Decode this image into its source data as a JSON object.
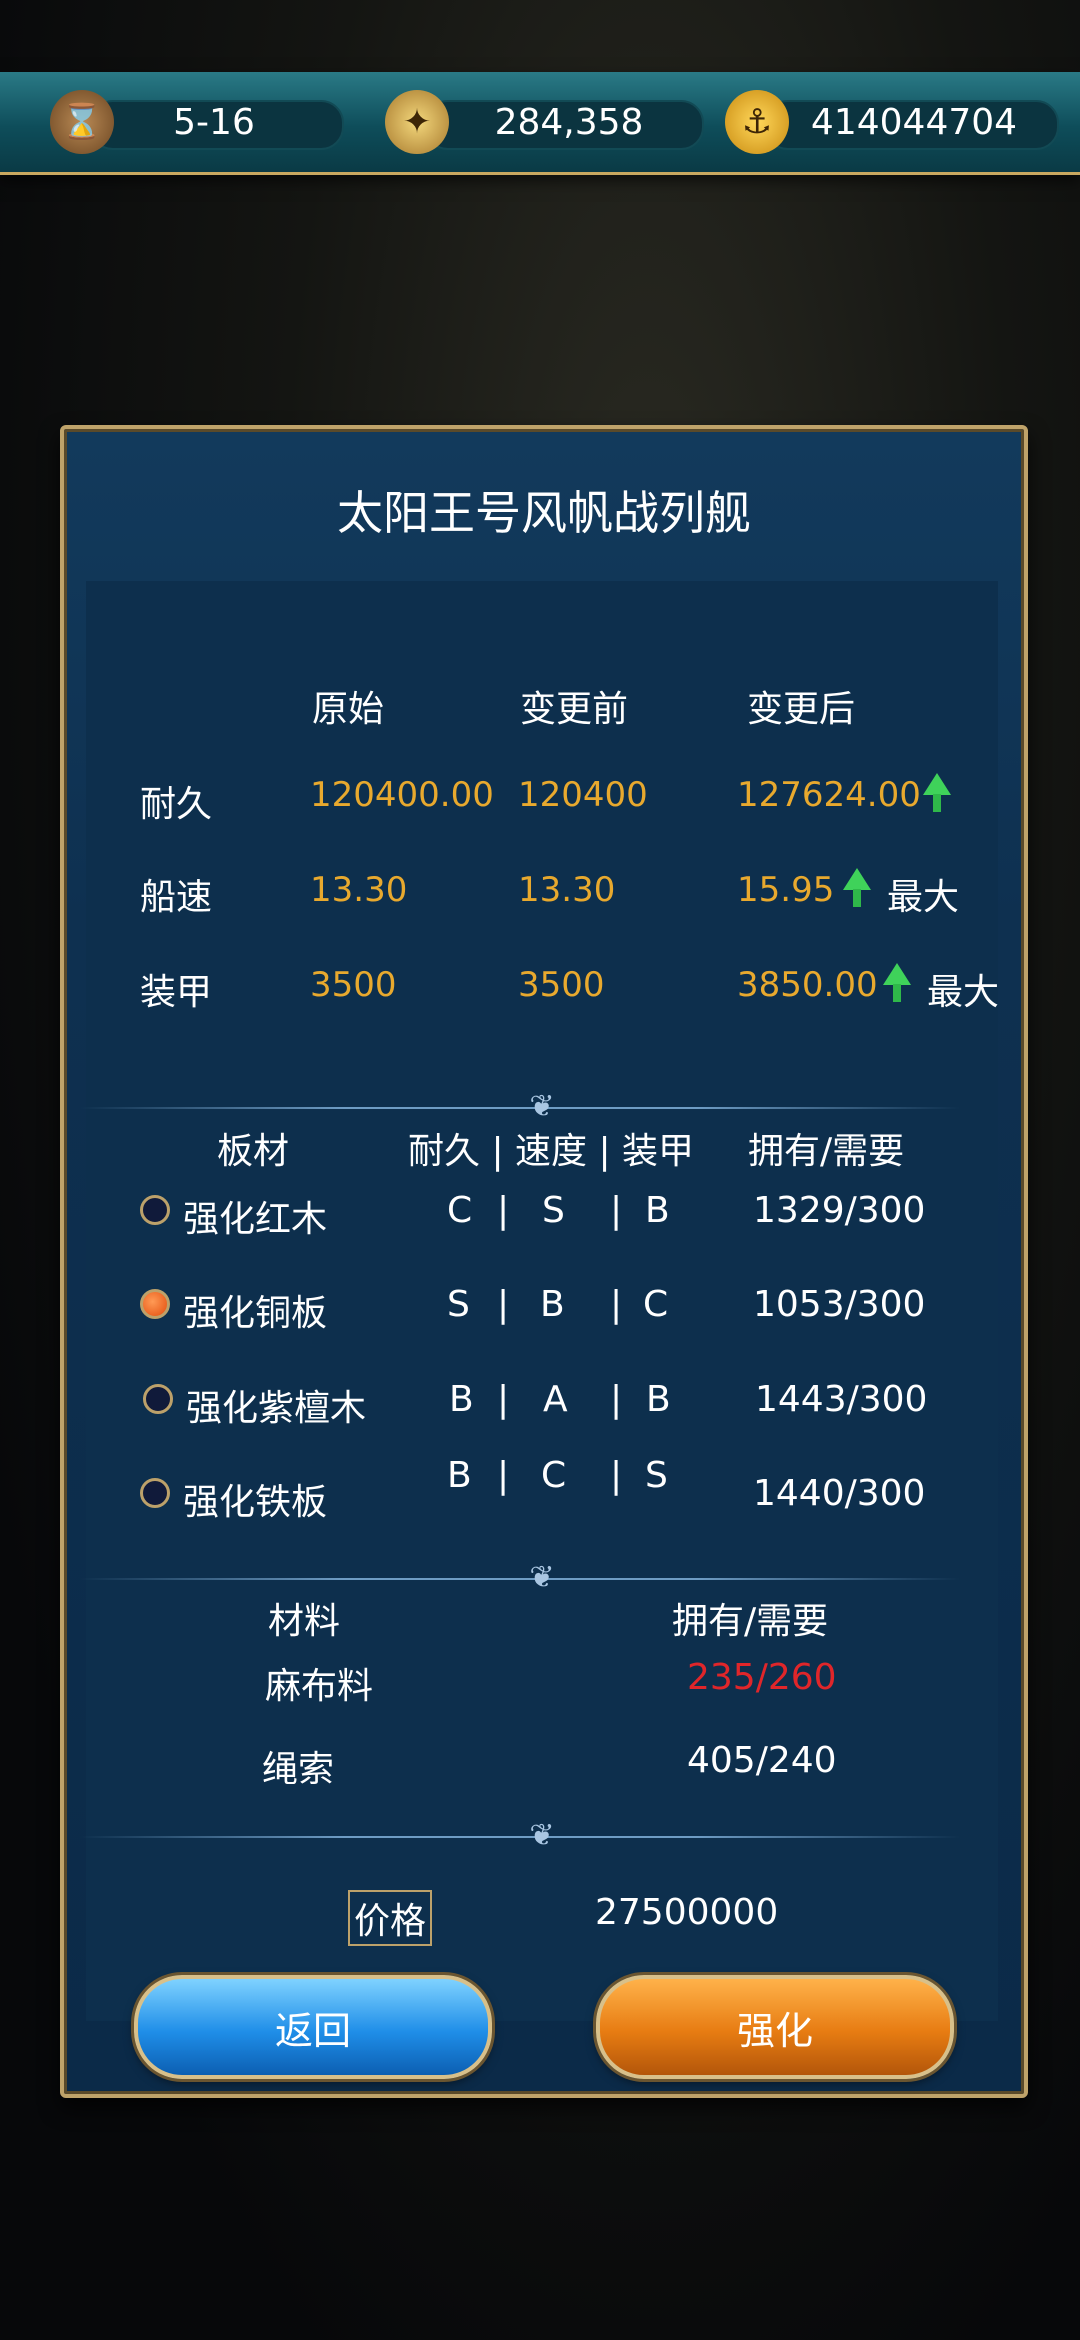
{
  "topbar": {
    "level": "5-16",
    "compass_value": "284,358",
    "gold_value": "414044704",
    "icons": [
      "hourglass-icon",
      "compass-icon",
      "anchor-coin-icon"
    ]
  },
  "dialog": {
    "title": "太阳王号风帆战列舰",
    "stats_headers": [
      "原始",
      "变更前",
      "变更后"
    ],
    "stats": [
      {
        "label": "耐久",
        "original": "120400.00",
        "before": "120400",
        "after": "127624.00",
        "max": ""
      },
      {
        "label": "船速",
        "original": "13.30",
        "before": "13.30",
        "after": "15.95",
        "max": "最大"
      },
      {
        "label": "装甲",
        "original": "3500",
        "before": "3500",
        "after": "3850.00",
        "max": "最大"
      }
    ],
    "board_headers": {
      "material": "板材",
      "attrs": "耐久 | 速度 | 装甲",
      "own": "拥有/需要"
    },
    "boards": [
      {
        "name": "强化红木",
        "a": "C",
        "b": "S",
        "c": "B",
        "own": "1329/300",
        "selected": false
      },
      {
        "name": "强化铜板",
        "a": "S",
        "b": "B",
        "c": "C",
        "own": "1053/300",
        "selected": true
      },
      {
        "name": "强化紫檀木",
        "a": "B",
        "b": "A",
        "c": "B",
        "own": "1443/300",
        "selected": false
      },
      {
        "name": "强化铁板",
        "a": "B",
        "b": "C",
        "c": "S",
        "own": "1440/300",
        "selected": false
      }
    ],
    "mat_headers": {
      "material": "材料",
      "own": "拥有/需要"
    },
    "materials": [
      {
        "name": "麻布料",
        "own": "235/260",
        "insufficient": true
      },
      {
        "name": "绳索",
        "own": "405/240",
        "insufficient": false
      }
    ],
    "price_label": "价格",
    "price_value": "27500000",
    "back_label": "返回",
    "enhance_label": "强化"
  },
  "colors": {
    "accent": "#e8a92e",
    "warning": "#e0262a",
    "up_arrow": "#3fd25a"
  }
}
